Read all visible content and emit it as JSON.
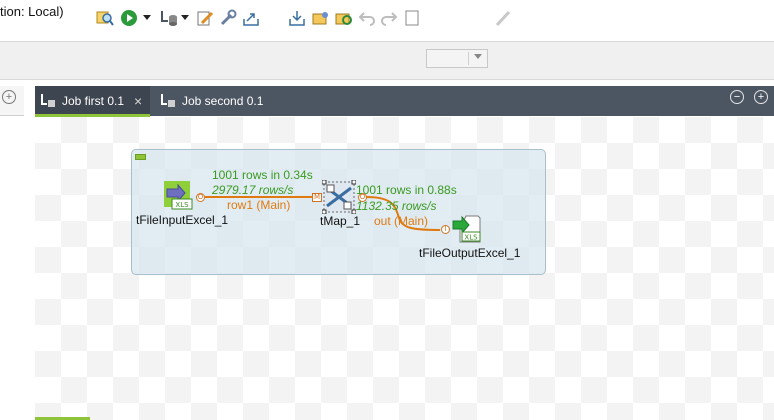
{
  "window": {
    "title_fragment": "tion: Local)"
  },
  "editor": {
    "tabs": [
      {
        "label": "Job first 0.1",
        "active": true
      },
      {
        "label": "Job second 0.1",
        "active": false
      }
    ],
    "close_glyph": "×",
    "minimize_glyph": "−",
    "maximize_glyph": "+"
  },
  "left_panel": {
    "add_glyph": "+"
  },
  "components": {
    "input": {
      "label": "tFileInputExcel_1",
      "icon": "xls-input-icon",
      "badge": "XLS"
    },
    "map": {
      "label": "tMap_1",
      "icon": "tmap-icon"
    },
    "output": {
      "label": "tFileOutputExcel_1",
      "icon": "xls-output-icon",
      "badge": "XLS"
    }
  },
  "flows": {
    "row1": {
      "stats_rows": "1001 rows in 0.34s",
      "stats_rate": "2979.17 rows/s",
      "label": "row1 (Main)"
    },
    "out": {
      "stats_rows": "1001 rows in 0.88s",
      "stats_rate": "1132.35 rows/s",
      "label": "out (Main)"
    }
  },
  "ports": {
    "output": "O",
    "map_input": "M",
    "map_output": "O",
    "input": "I"
  },
  "colors": {
    "accent": "#8fc33a",
    "tab_bar": "#4c5562",
    "flow_line": "#e07a10",
    "stats": "#3a9a20"
  }
}
